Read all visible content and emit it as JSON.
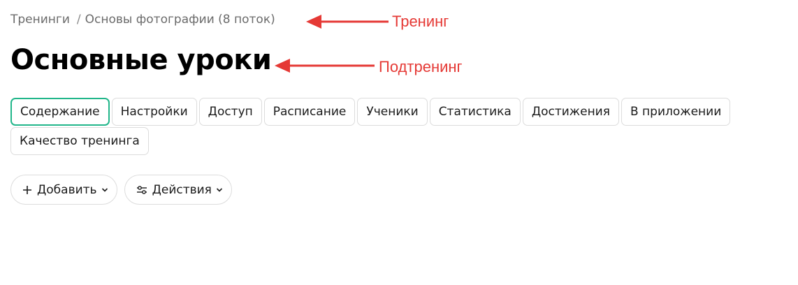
{
  "breadcrumb": {
    "root": "Тренинги",
    "separator": "/",
    "current": "Основы фотографии (8 поток)"
  },
  "page_title": "Основные уроки",
  "annotations": {
    "training_label": "Тренинг",
    "subtraining_label": "Подтренинг",
    "color": "#e53935"
  },
  "tabs": [
    {
      "label": "Содержание",
      "active": true
    },
    {
      "label": "Настройки"
    },
    {
      "label": "Доступ"
    },
    {
      "label": "Расписание"
    },
    {
      "label": "Ученики"
    },
    {
      "label": "Статистика"
    },
    {
      "label": "Достижения"
    },
    {
      "label": "В приложении"
    },
    {
      "label": "Качество тренинга"
    }
  ],
  "actions": {
    "add_label": "Добавить",
    "actions_label": "Действия"
  },
  "colors": {
    "active_tab_border": "#21b68a",
    "border": "#dcdcdc",
    "breadcrumb_text": "#6b6b6b"
  }
}
